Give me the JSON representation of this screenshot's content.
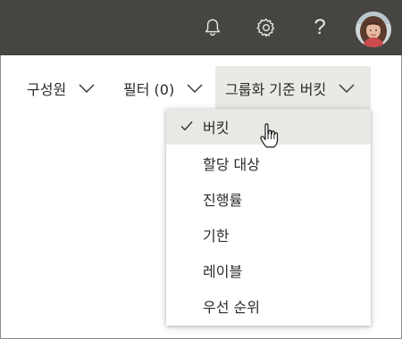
{
  "header": {
    "icons": [
      "bell-icon",
      "gear-icon",
      "help-icon",
      "avatar"
    ],
    "help_glyph": "?",
    "background": "#474541"
  },
  "toolbar": {
    "members_label": "구성원",
    "filter_label": "필터 (0)",
    "group_label": "그룹화 기준 버킷"
  },
  "group_menu": {
    "selected": "버킷",
    "options": [
      "버킷",
      "할당 대상",
      "진행률",
      "기한",
      "레이블",
      "우선 순위"
    ]
  }
}
